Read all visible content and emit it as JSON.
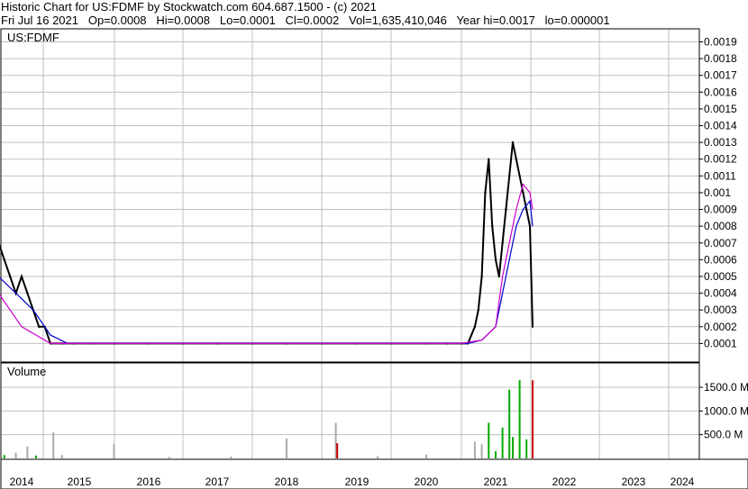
{
  "header": {
    "title_line": "Historic Chart for US:FDMF by Stockwatch.com 604.687.1500 - (c) 2021",
    "date": "Fri Jul 16 2021",
    "open": "Op=0.0008",
    "high": "Hi=0.0008",
    "low": "Lo=0.0001",
    "close": "Cl=0.0002",
    "volume": "Vol=1,635,410,046",
    "year_high": "Year hi=0.0017",
    "year_low": "lo=0.000001"
  },
  "chart_data": [
    {
      "type": "line",
      "label": "US:FDMF",
      "y_range": [
        0,
        0.0019
      ],
      "y_ticks": [
        "0.0019",
        "0.0018",
        "0.0017",
        "0.0016",
        "0.0015",
        "0.0014",
        "0.0013",
        "0.0012",
        "0.0011",
        "0.001",
        "0.0009",
        "0.0008",
        "0.0007",
        "0.0006",
        "0.0005",
        "0.0004",
        "0.0003",
        "0.0002",
        "0.0001"
      ],
      "x_ticks": [
        "2014",
        "2015",
        "2016",
        "2017",
        "2018",
        "2019",
        "2020",
        "2021",
        "2022",
        "2023",
        "2024"
      ],
      "series": [
        {
          "name": "price",
          "color": "#000000",
          "x": [
            2013.6,
            2013.7,
            2013.8,
            2013.9,
            2014.0,
            2014.1,
            2014.2,
            2014.3,
            2014.4,
            2014.5,
            2014.7,
            2014.9,
            2015.2,
            2015.5,
            2016.0,
            2016.5,
            2017.0,
            2017.5,
            2018.0,
            2018.5,
            2019.0,
            2019.5,
            2020.0,
            2020.3,
            2020.5,
            2020.6,
            2020.7,
            2020.75,
            2020.8,
            2020.85,
            2020.9,
            2020.95,
            2021.0,
            2021.05,
            2021.1,
            2021.15,
            2021.2,
            2021.25,
            2021.3,
            2021.35,
            2021.4,
            2021.45,
            2021.5,
            2021.54
          ],
          "y": [
            0.0007,
            0.0006,
            0.0005,
            0.0004,
            0.0005,
            0.0004,
            0.0003,
            0.0002,
            0.0002,
            0.0001,
            0.0001,
            0.0001,
            0.0001,
            0.0001,
            0.0001,
            0.0001,
            0.0001,
            0.0001,
            0.0001,
            0.0001,
            0.0001,
            0.0001,
            0.0001,
            0.0001,
            0.0001,
            0.0001,
            0.0002,
            0.0003,
            0.0005,
            0.001,
            0.0012,
            0.0008,
            0.0006,
            0.0005,
            0.0007,
            0.0009,
            0.0011,
            0.0013,
            0.0012,
            0.0011,
            0.001,
            0.0009,
            0.0008,
            0.0002
          ]
        },
        {
          "name": "moving-average-blue",
          "color": "#0000cc",
          "x": [
            2013.6,
            2013.9,
            2014.2,
            2014.5,
            2014.8,
            2015.5,
            2016.5,
            2017.5,
            2018.5,
            2019.5,
            2020.3,
            2020.6,
            2020.8,
            2021.0,
            2021.1,
            2021.2,
            2021.3,
            2021.4,
            2021.5,
            2021.54
          ],
          "y": [
            0.0005,
            0.0004,
            0.0003,
            0.00015,
            0.0001,
            0.0001,
            0.0001,
            0.0001,
            0.0001,
            0.0001,
            0.0001,
            0.0001,
            0.00012,
            0.0002,
            0.0004,
            0.0006,
            0.0008,
            0.0009,
            0.00095,
            0.0008
          ]
        },
        {
          "name": "moving-average-purple",
          "color": "#cc00cc",
          "x": [
            2013.6,
            2014.0,
            2014.5,
            2015.0,
            2016.0,
            2017.0,
            2018.0,
            2019.0,
            2020.0,
            2020.5,
            2020.8,
            2021.0,
            2021.1,
            2021.2,
            2021.3,
            2021.4,
            2021.5,
            2021.54
          ],
          "y": [
            0.0004,
            0.0002,
            0.0001,
            0.0001,
            0.0001,
            0.0001,
            0.0001,
            0.0001,
            0.0001,
            0.0001,
            0.00012,
            0.0002,
            0.0005,
            0.0007,
            0.0009,
            0.00105,
            0.001,
            0.0009
          ]
        }
      ]
    },
    {
      "type": "bar",
      "label": "Volume",
      "unit": "M",
      "y_range": [
        0,
        1900
      ],
      "y_ticks": [
        "1500.0 M",
        "1000.0 M",
        "500.0 M"
      ],
      "bars": [
        {
          "x": 2013.7,
          "value": 70,
          "color": "#00aa00"
        },
        {
          "x": 2013.9,
          "value": 120,
          "color": "#aaaaaa"
        },
        {
          "x": 2014.1,
          "value": 250,
          "color": "#aaaaaa"
        },
        {
          "x": 2014.25,
          "value": 60,
          "color": "#00aa00"
        },
        {
          "x": 2014.55,
          "value": 550,
          "color": "#aaaaaa"
        },
        {
          "x": 2014.7,
          "value": 70,
          "color": "#aaaaaa"
        },
        {
          "x": 2015.5,
          "value": 300,
          "color": "#aaaaaa"
        },
        {
          "x": 2016.3,
          "value": 30,
          "color": "#aaaaaa"
        },
        {
          "x": 2017.2,
          "value": 40,
          "color": "#aaaaaa"
        },
        {
          "x": 2018.0,
          "value": 420,
          "color": "#aaaaaa"
        },
        {
          "x": 2018.7,
          "value": 750,
          "color": "#aaaaaa"
        },
        {
          "x": 2018.72,
          "value": 320,
          "color": "#cc0000"
        },
        {
          "x": 2019.3,
          "value": 50,
          "color": "#aaaaaa"
        },
        {
          "x": 2020.0,
          "value": 80,
          "color": "#aaaaaa"
        },
        {
          "x": 2020.7,
          "value": 350,
          "color": "#aaaaaa"
        },
        {
          "x": 2020.8,
          "value": 300,
          "color": "#aaaaaa"
        },
        {
          "x": 2020.9,
          "value": 750,
          "color": "#00aa00"
        },
        {
          "x": 2021.0,
          "value": 150,
          "color": "#00aa00"
        },
        {
          "x": 2021.1,
          "value": 650,
          "color": "#00aa00"
        },
        {
          "x": 2021.2,
          "value": 1450,
          "color": "#00aa00"
        },
        {
          "x": 2021.25,
          "value": 450,
          "color": "#00aa00"
        },
        {
          "x": 2021.35,
          "value": 1650,
          "color": "#00aa00"
        },
        {
          "x": 2021.45,
          "value": 400,
          "color": "#00aa00"
        },
        {
          "x": 2021.54,
          "value": 1650,
          "color": "#cc0000"
        }
      ]
    }
  ]
}
